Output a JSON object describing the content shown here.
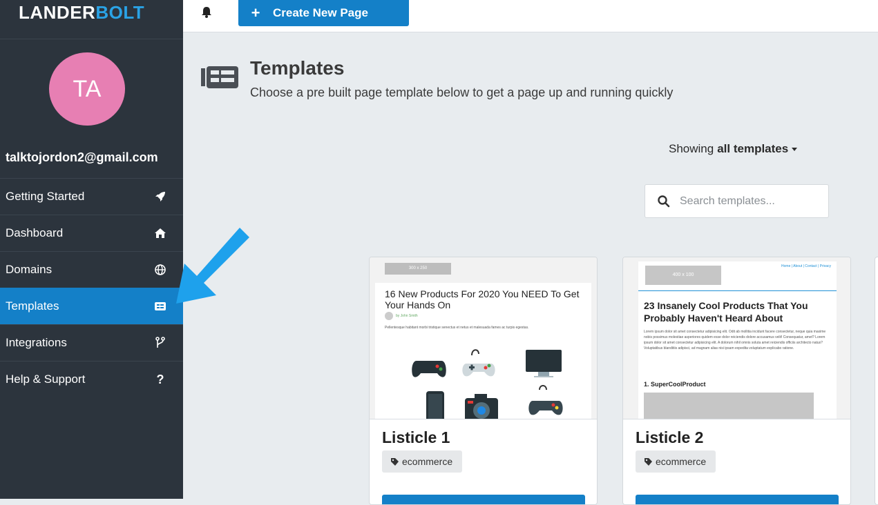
{
  "brand": {
    "logo_part1": "LANDER",
    "logo_part2": "BOLT"
  },
  "user": {
    "initials": "TA",
    "email": "talktojordon2@gmail.com"
  },
  "sidebar": {
    "items": [
      {
        "label": "Getting Started",
        "icon": "rocket-icon"
      },
      {
        "label": "Dashboard",
        "icon": "home-icon"
      },
      {
        "label": "Domains",
        "icon": "globe-icon"
      },
      {
        "label": "Templates",
        "icon": "templates-icon",
        "active": true
      },
      {
        "label": "Integrations",
        "icon": "branch-icon"
      },
      {
        "label": "Help & Support",
        "icon": "question-icon"
      }
    ]
  },
  "topbar": {
    "create_label": "Create New Page"
  },
  "page": {
    "title": "Templates",
    "subtitle": "Choose a pre built page template below to get a page up and running quickly"
  },
  "filter": {
    "showing_prefix": "Showing",
    "showing_value": "all templates"
  },
  "search": {
    "placeholder": "Search templates..."
  },
  "templates": [
    {
      "name": "Listicle 1",
      "tag": "ecommerce",
      "preview": {
        "ad_label": "300 x 250",
        "headline": "16 New Products For 2020 You NEED To Get Your Hands On",
        "byline": "by John Smith",
        "body": "Pellentesque habitant morbi tristique senectus et netus et malesuada fames ac turpis egestas."
      }
    },
    {
      "name": "Listicle 2",
      "tag": "ecommerce",
      "preview": {
        "ad_label": "400 x 100",
        "links": "Home | About | Contact | Privacy",
        "headline": "23 Insanely Cool Products That You Probably Haven't Heard About",
        "body": "Lorem ipsum dolor sit amet consectetur adipisicing elit. Odit ab mollitia incidunt facere consectetur, neque quia maxime nobis possimus molestiae asperiores quidem esse dolor reiciendis dolore accusamus velit! Consequatur, amet? Lorem ipsum dolor sit amet consectetur adipisicing elit. A dolorum nihil omnis soluta amet reiciendis officiis architecto natus? Voluptatibus blanditiis adipisci, ad magnam alias nisi ipsam expedita voluptatum explicabo ratione.",
        "subheading": "1. SuperCoolProduct"
      }
    }
  ],
  "colors": {
    "accent": "#1480c8",
    "sidebar": "#2c343d",
    "avatar": "#e77fb3",
    "arrow": "#1ea1ec"
  }
}
